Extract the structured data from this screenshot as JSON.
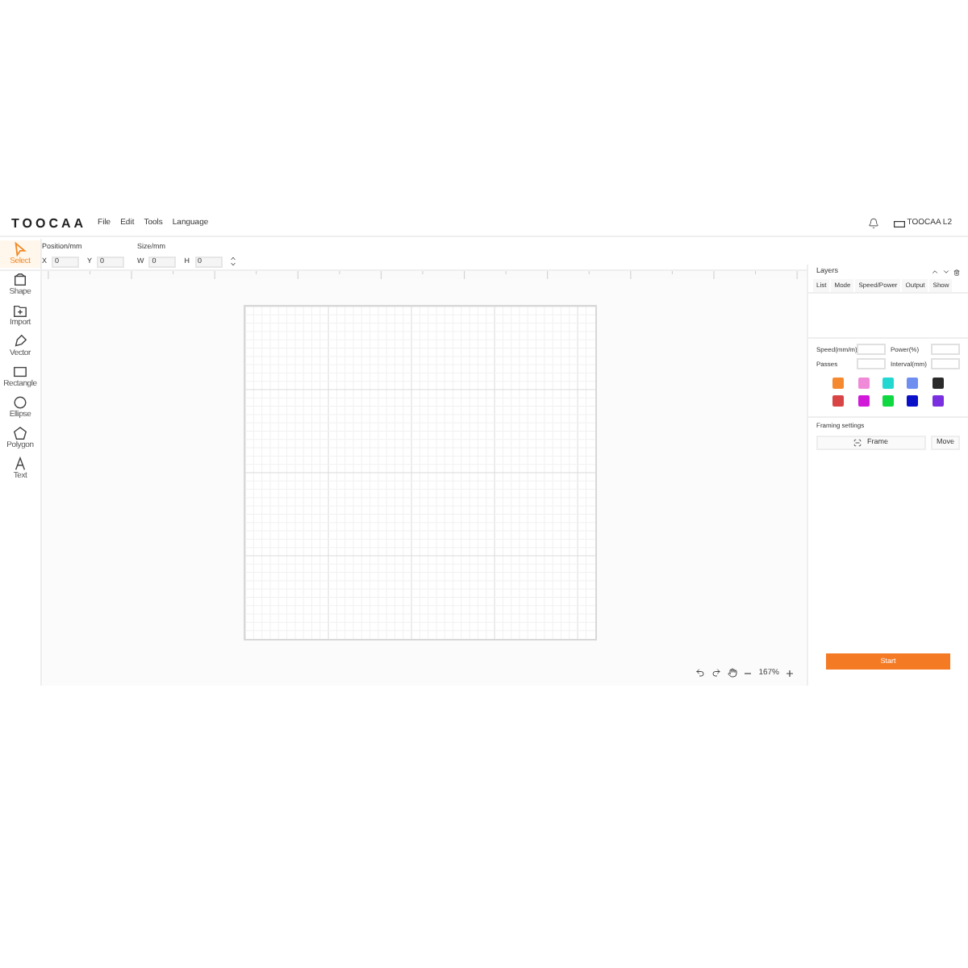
{
  "app": {
    "logo": "TOOCAA",
    "menu": [
      "File",
      "Edit",
      "Tools",
      "Language"
    ],
    "device": "TOOCAA L2"
  },
  "toolbar": {
    "position_label": "Position/mm",
    "size_label": "Size/mm",
    "fields": [
      {
        "label": "X",
        "value": "0"
      },
      {
        "label": "Y",
        "value": "0"
      },
      {
        "label": "W",
        "value": "0"
      },
      {
        "label": "H",
        "value": "0"
      }
    ]
  },
  "tools": [
    {
      "label": "Select",
      "kind": "select",
      "selected": true
    },
    {
      "label": "Shape",
      "kind": "shape",
      "selected": false
    },
    {
      "label": "Import",
      "kind": "import",
      "selected": false
    },
    {
      "label": "Vector",
      "kind": "vector",
      "selected": false
    },
    {
      "label": "Rectangle",
      "kind": "rectangle",
      "selected": false
    },
    {
      "label": "Ellipse",
      "kind": "ellipse",
      "selected": false
    },
    {
      "label": "Polygon",
      "kind": "polygon",
      "selected": false
    },
    {
      "label": "Text",
      "kind": "text",
      "selected": false
    }
  ],
  "canvas": {
    "zoom": "167%"
  },
  "layers": {
    "title": "Layers",
    "columns": [
      "List",
      "Mode",
      "Speed/Power",
      "Output",
      "Show"
    ],
    "params": [
      {
        "label": "Speed(mm/m)"
      },
      {
        "label": "Power(%)"
      },
      {
        "label": "Passes"
      },
      {
        "label": "Interval(mm)"
      }
    ],
    "swatches": [
      {
        "color": "#f5892f"
      },
      {
        "color": "#f08ad8"
      },
      {
        "color": "#22d8d0"
      },
      {
        "color": "#6f8ff0"
      },
      {
        "color": "#2a2a2a"
      },
      {
        "color": "#d94545"
      },
      {
        "color": "#d01ad8"
      },
      {
        "color": "#10d840"
      },
      {
        "color": "#0a10c8"
      },
      {
        "color": "#7a30e0"
      }
    ]
  },
  "framing": {
    "title": "Framing settings",
    "frame_button": "Frame",
    "move_button": "Move"
  },
  "start_button": "Start"
}
